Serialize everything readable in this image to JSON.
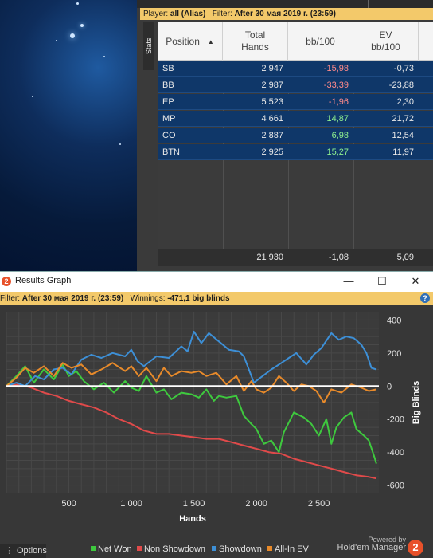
{
  "stats_window": {
    "filter_prefix": "Player:",
    "player": "all (Alias)",
    "filter_label": "Filter:",
    "filter_value": "After 30 мая 2019 г. (23:59)",
    "side_tab": "Stats",
    "columns": [
      "Position",
      "Total Hands",
      "bb/100",
      "EV bb/100"
    ],
    "rows": [
      {
        "position": "SB",
        "hands": "2 947",
        "bb100": "-15,98",
        "ev": "-0,73",
        "sign": "neg"
      },
      {
        "position": "BB",
        "hands": "2 987",
        "bb100": "-33,39",
        "ev": "-23,88",
        "sign": "neg"
      },
      {
        "position": "EP",
        "hands": "5 523",
        "bb100": "-1,96",
        "ev": "2,30",
        "sign": "neg"
      },
      {
        "position": "MP",
        "hands": "4 661",
        "bb100": "14,87",
        "ev": "21,72",
        "sign": "pos"
      },
      {
        "position": "CO",
        "hands": "2 887",
        "bb100": "6,98",
        "ev": "12,54",
        "sign": "pos"
      },
      {
        "position": "BTN",
        "hands": "2 925",
        "bb100": "15,27",
        "ev": "11,97",
        "sign": "pos"
      }
    ],
    "totals": {
      "hands": "21 930",
      "bb100": "-1,08",
      "ev": "5,09"
    }
  },
  "graph_window": {
    "title": "Results Graph",
    "min_glyph": "—",
    "max_glyph": "☐",
    "close_glyph": "✕",
    "filter_label": "Filter:",
    "filter_value": "After 30 мая 2019 г. (23:59)",
    "winnings_label": "Winnings:",
    "winnings_value": "-471,1 big blinds",
    "options_label": "Options",
    "powered_by": "Powered by",
    "brand": "Hold'em Manager",
    "logo_glyph": "2"
  },
  "chart_data": {
    "type": "line",
    "xlabel": "Hands",
    "ylabel": "Big Blinds",
    "xlim": [
      0,
      2980
    ],
    "ylim": [
      -650,
      450
    ],
    "x_ticks": [
      500,
      1000,
      1500,
      2000,
      2500
    ],
    "x_tick_labels": [
      "500",
      "1 000",
      "1 500",
      "2 000",
      "2 500"
    ],
    "y_ticks": [
      400,
      200,
      0,
      -200,
      -400,
      -600
    ],
    "y_tick_labels": [
      "400",
      "200",
      "0",
      "-200",
      "-400",
      "-600"
    ],
    "grid": true,
    "legend_position": "bottom",
    "series": [
      {
        "name": "Net Won",
        "color": "#3ec93e",
        "x": [
          0,
          80,
          150,
          220,
          300,
          380,
          450,
          500,
          560,
          620,
          700,
          780,
          860,
          950,
          1000,
          1060,
          1120,
          1200,
          1260,
          1320,
          1400,
          1480,
          1540,
          1600,
          1660,
          1700,
          1760,
          1840,
          1900,
          1960,
          2000,
          2060,
          2120,
          2180,
          2220,
          2260,
          2300,
          2380,
          2440,
          2500,
          2560,
          2600,
          2640,
          2700,
          2760,
          2800,
          2860,
          2900,
          2940,
          2960
        ],
        "y": [
          0,
          60,
          120,
          20,
          100,
          40,
          130,
          60,
          90,
          30,
          -20,
          20,
          -40,
          30,
          -10,
          -30,
          60,
          -40,
          -20,
          -80,
          -40,
          -50,
          -70,
          -20,
          -90,
          -60,
          -70,
          -60,
          -180,
          -230,
          -260,
          -350,
          -330,
          -400,
          -280,
          -220,
          -160,
          -190,
          -230,
          -300,
          -200,
          -350,
          -250,
          -190,
          -160,
          -260,
          -300,
          -330,
          -420,
          -470
        ]
      },
      {
        "name": "Non Showdown",
        "color": "#e04a4a",
        "x": [
          0,
          100,
          200,
          300,
          400,
          500,
          600,
          700,
          800,
          900,
          1000,
          1100,
          1200,
          1300,
          1400,
          1500,
          1600,
          1700,
          1800,
          1900,
          2000,
          2100,
          2200,
          2300,
          2400,
          2500,
          2600,
          2700,
          2800,
          2900,
          2960
        ],
        "y": [
          0,
          10,
          -10,
          -40,
          -60,
          -90,
          -110,
          -130,
          -160,
          -200,
          -230,
          -270,
          -290,
          -290,
          -300,
          -310,
          -320,
          -320,
          -340,
          -360,
          -380,
          -400,
          -410,
          -440,
          -460,
          -480,
          -500,
          -520,
          -540,
          -550,
          -560
        ]
      },
      {
        "name": "Showdown",
        "color": "#3d8fd6",
        "x": [
          0,
          80,
          150,
          230,
          300,
          380,
          450,
          520,
          600,
          680,
          760,
          850,
          950,
          1000,
          1050,
          1100,
          1200,
          1300,
          1400,
          1450,
          1500,
          1560,
          1620,
          1700,
          1780,
          1860,
          1900,
          1980,
          2050,
          2120,
          2200,
          2260,
          2320,
          2400,
          2460,
          2520,
          2600,
          2660,
          2720,
          2780,
          2840,
          2880,
          2920,
          2960
        ],
        "y": [
          0,
          20,
          0,
          60,
          40,
          100,
          110,
          70,
          160,
          190,
          170,
          200,
          180,
          220,
          150,
          120,
          180,
          170,
          240,
          210,
          330,
          260,
          320,
          270,
          220,
          210,
          180,
          20,
          60,
          100,
          140,
          170,
          200,
          130,
          190,
          230,
          320,
          280,
          300,
          290,
          250,
          200,
          110,
          100
        ]
      },
      {
        "name": "All-In EV",
        "color": "#e88a2a",
        "x": [
          0,
          80,
          150,
          220,
          300,
          380,
          450,
          520,
          600,
          680,
          760,
          850,
          950,
          1000,
          1060,
          1120,
          1200,
          1260,
          1320,
          1400,
          1480,
          1540,
          1600,
          1680,
          1760,
          1840,
          1900,
          1960,
          2000,
          2060,
          2120,
          2180,
          2240,
          2300,
          2360,
          2420,
          2480,
          2540,
          2600,
          2680,
          2760,
          2840,
          2900,
          2960
        ],
        "y": [
          0,
          50,
          110,
          80,
          120,
          60,
          140,
          110,
          130,
          70,
          100,
          140,
          90,
          120,
          60,
          110,
          30,
          110,
          60,
          90,
          80,
          90,
          60,
          80,
          10,
          60,
          -30,
          30,
          -20,
          -40,
          -10,
          60,
          20,
          -30,
          10,
          0,
          -30,
          -100,
          -20,
          -40,
          10,
          -10,
          -30,
          -20
        ]
      }
    ]
  }
}
